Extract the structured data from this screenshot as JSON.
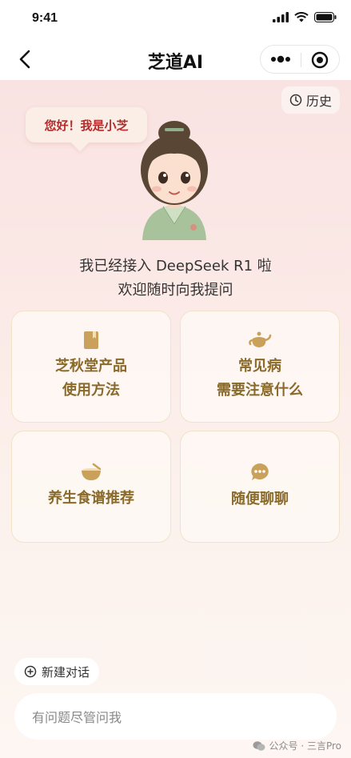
{
  "status_bar": {
    "time": "9:41"
  },
  "nav": {
    "title": "芝道AI"
  },
  "history": {
    "label": "历史"
  },
  "greeting": {
    "bubble": "您好！我是小芝"
  },
  "intro": {
    "line1": "我已经接入 DeepSeek R1 啦",
    "line2": "欢迎随时向我提问"
  },
  "cards": [
    {
      "line1": "芝秋堂产品",
      "line2": "使用方法",
      "icon": "book-icon"
    },
    {
      "line1": "常见病",
      "line2": "需要注意什么",
      "icon": "teapot-icon"
    },
    {
      "line1": "养生食谱推荐",
      "line2": "",
      "icon": "bowl-icon"
    },
    {
      "line1": "随便聊聊",
      "line2": "",
      "icon": "chat-bubble-icon"
    }
  ],
  "new_chat": {
    "label": "新建对话"
  },
  "input": {
    "placeholder": "有问题尽管问我"
  },
  "watermark": {
    "text": "公众号 · 三言Pro"
  },
  "colors": {
    "accent_gold": "#c9a15a",
    "greeting_red": "#b32b2b",
    "card_text": "#8a6a2a"
  }
}
